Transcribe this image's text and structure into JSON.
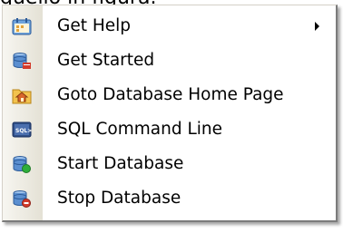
{
  "caption": "quello in figura.",
  "menu": {
    "items": [
      {
        "label": "Get Help",
        "icon": "help-calendar-icon",
        "has_submenu": true
      },
      {
        "label": "Get Started",
        "icon": "database-start-icon",
        "has_submenu": false
      },
      {
        "label": "Goto Database Home Page",
        "icon": "home-folder-icon",
        "has_submenu": false
      },
      {
        "label": "SQL Command Line",
        "icon": "sql-console-icon",
        "has_submenu": false
      },
      {
        "label": "Start Database",
        "icon": "database-start-green-icon",
        "has_submenu": false
      },
      {
        "label": "Stop Database",
        "icon": "database-stop-red-icon",
        "has_submenu": false
      }
    ],
    "colors": {
      "icon_blue": "#3c6fb6",
      "start_green": "#2fae3a",
      "stop_red": "#d23b2b"
    }
  }
}
